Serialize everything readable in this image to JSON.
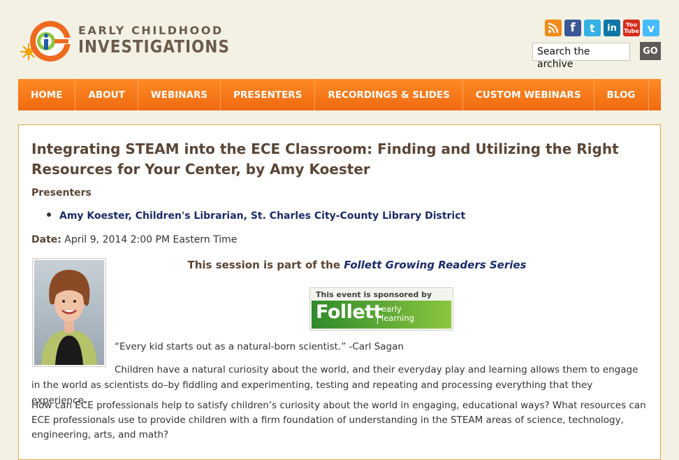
{
  "site": {
    "logo_line1": "EARLY CHILDHOOD",
    "logo_line2": "INVESTIGATIONS"
  },
  "header": {
    "social_icons": [
      "rss-icon",
      "facebook-icon",
      "twitter-icon",
      "linkedin-icon",
      "youtube-icon",
      "vimeo-icon"
    ],
    "search_value": "Search the archive",
    "go_label": "GO"
  },
  "nav": {
    "items": [
      "HOME",
      "ABOUT",
      "WEBINARS",
      "PRESENTERS",
      "RECORDINGS & SLIDES",
      "CUSTOM WEBINARS",
      "BLOG"
    ]
  },
  "article": {
    "title": "Integrating STEAM into the ECE Classroom: Finding and Utilizing the Right Resources for Your Center, by Amy Koester",
    "presenters_heading": "Presenters",
    "presenter": "Amy Koester, Children's Librarian, St. Charles City-County Library District",
    "date_label": "Date:",
    "date_value": " April 9, 2014 2:00 PM Eastern Time",
    "series_prefix": "This session is part of the ",
    "series_link": "Follett Growing Readers Series",
    "sponsor_top": "This event is sponsored by",
    "sponsor_name": "Follett",
    "sponsor_sub1": "early",
    "sponsor_sub2": "learning",
    "quote": "“Every kid starts out as a natural-born scientist.” -Carl Sagan",
    "para1": "Children have a natural curiosity about the world, and their everyday play and learning allows them to engage in the world as scientists do–by fiddling and experimenting, testing and repeating and processing everything that they experience.",
    "para2": "How can ECE professionals help to satisfy children’s curiosity about the world in engaging, educational ways? What resources can ECE professionals use to provide children with a firm foundation of understanding in the STEAM areas of science, technology, engineering, arts, and math?"
  },
  "colors": {
    "nav_orange": "#f47a1a",
    "title_brown": "#5b4636",
    "link_navy": "#1a2c68",
    "background": "#f3f1e4"
  }
}
